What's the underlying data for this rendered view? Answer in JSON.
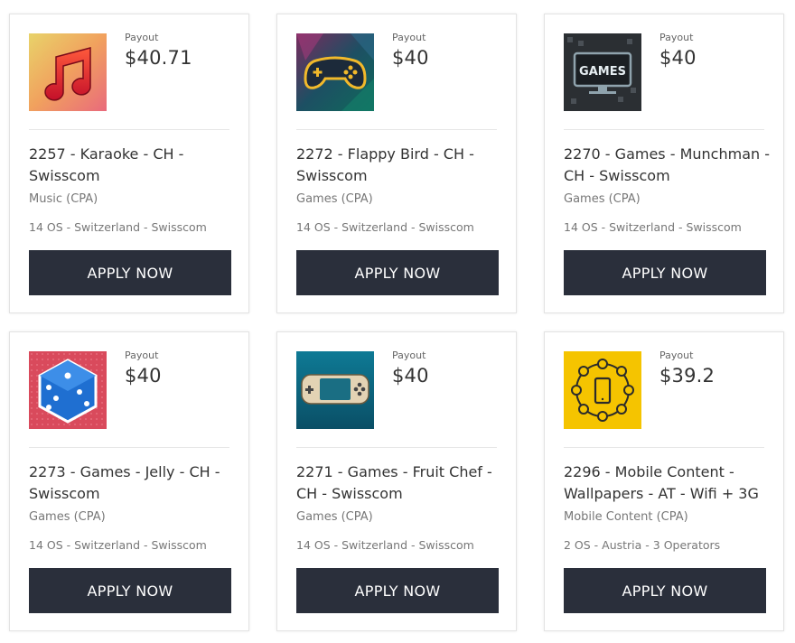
{
  "offers": [
    {
      "id": "offer-2257",
      "thumb": "music-note-icon",
      "payout_label": "Payout",
      "payout": "$40.71",
      "title": "2257 - Karaoke - CH - Swisscom",
      "category": "Music (CPA)",
      "meta": "14 OS - Switzerland - Swisscom",
      "cta": "APPLY NOW"
    },
    {
      "id": "offer-2272",
      "thumb": "gamepad-icon",
      "payout_label": "Payout",
      "payout": "$40",
      "title": "2272 - Flappy Bird - CH - Swisscom",
      "category": "Games (CPA)",
      "meta": "14 OS - Switzerland - Swisscom",
      "cta": "APPLY NOW"
    },
    {
      "id": "offer-2270",
      "thumb": "games-monitor-icon",
      "thumb_text": "GAMES",
      "payout_label": "Payout",
      "payout": "$40",
      "title": "2270 - Games - Munchman - CH - Swisscom",
      "category": "Games (CPA)",
      "meta": "14 OS - Switzerland - Swisscom",
      "cta": "APPLY NOW"
    },
    {
      "id": "offer-2273",
      "thumb": "dice-icon",
      "payout_label": "Payout",
      "payout": "$40",
      "title": "2273 - Games - Jelly - CH - Swisscom",
      "category": "Games (CPA)",
      "meta": "14 OS - Switzerland - Swisscom",
      "cta": "APPLY NOW"
    },
    {
      "id": "offer-2271",
      "thumb": "handheld-console-icon",
      "payout_label": "Payout",
      "payout": "$40",
      "title": "2271 - Games - Fruit Chef - CH - Swisscom",
      "category": "Games (CPA)",
      "meta": "14 OS - Switzerland - Swisscom",
      "cta": "APPLY NOW"
    },
    {
      "id": "offer-2296",
      "thumb": "mobile-apps-icon",
      "payout_label": "Payout",
      "payout": "$39.2",
      "title": "2296 - Mobile Content - Wallpapers - AT - Wifi + 3G",
      "category": "Mobile Content (CPA)",
      "meta": "2 OS - Austria - 3 Operators",
      "cta": "APPLY NOW"
    }
  ]
}
